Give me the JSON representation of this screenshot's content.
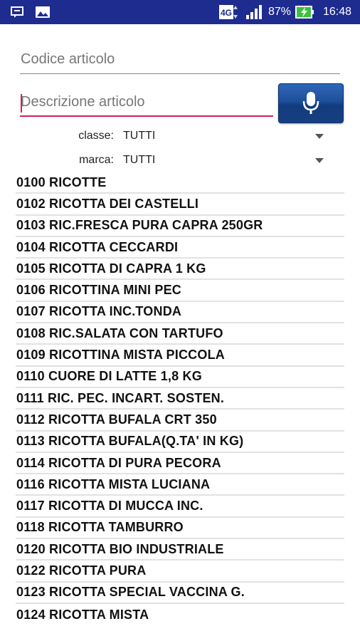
{
  "status_bar": {
    "network": "4G",
    "battery_percent": "87%",
    "time": "16:48",
    "icons": [
      "notification-icon",
      "gallery-icon",
      "network-4g-icon",
      "signal-icon",
      "battery-charging-icon"
    ]
  },
  "search": {
    "code_placeholder": "Codice articolo",
    "desc_placeholder": "Descrizione articolo",
    "mic_icon": "microphone-icon"
  },
  "filters": {
    "classe_label": "classe:",
    "classe_value": "TUTTI",
    "marca_label": "marca:",
    "marca_value": "TUTTI"
  },
  "items": [
    "0100 RICOTTE",
    "0102 RICOTTA DEI CASTELLI",
    "0103 RIC.FRESCA PURA CAPRA 250GR",
    "0104 RICOTTA CECCARDI",
    "0105 RICOTTA DI CAPRA 1 KG",
    "0106 RICOTTINA MINI PEC",
    "0107 RICOTTA INC.TONDA",
    "0108 RIC.SALATA CON TARTUFO",
    "0109 RICOTTINA MISTA PICCOLA",
    "0110 CUORE DI LATTE 1,8 KG",
    "0111 RIC. PEC. INCART. SOSTEN.",
    "0112 RICOTTA BUFALA CRT 350",
    "0113 RICOTTA BUFALA(Q.TA' IN KG)",
    "0114 RICOTTA DI PURA PECORA",
    "0116 RICOTTA MISTA LUCIANA",
    "0117 RICOTTA DI MUCCA INC.",
    "0118 RICOTTA TAMBURRO",
    "0120 RICOTTA BIO INDUSTRIALE",
    "0122 RICOTTA PURA",
    "0123 RICOTTA SPECIAL VACCINA G.",
    "0124 RICOTTA MISTA"
  ],
  "colors": {
    "status_bar": "#1e2b8f",
    "accent": "#d81b60",
    "button": "#1d4f9a"
  }
}
